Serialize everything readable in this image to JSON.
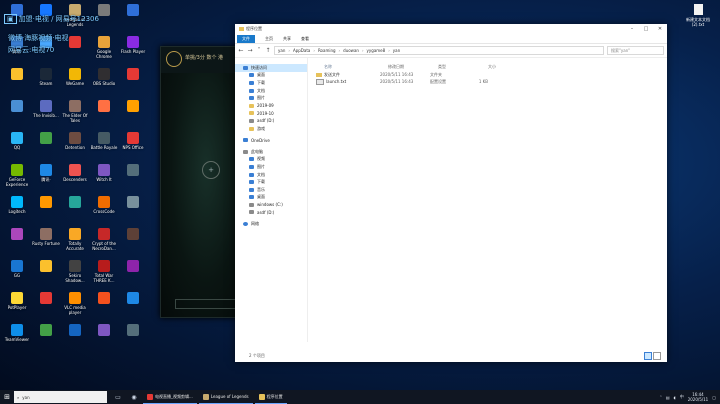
{
  "overlay": {
    "line1": "加盟·电视 / 网易号12306",
    "line2": "微博·海豚视频·电视",
    "line3": "网易云:电视70"
  },
  "desktop_icons": [
    {
      "label": "",
      "color": "#2f6fd8"
    },
    {
      "label": "",
      "color": "#1677ff"
    },
    {
      "label": "League of Legends",
      "color": "#c8aa6e"
    },
    {
      "label": "",
      "color": "#7a7a7a"
    },
    {
      "label": "",
      "color": "#2f6fd8"
    },
    {
      "label": "腾讯·",
      "color": "#3a7fd4"
    },
    {
      "label": "",
      "color": "#4aa8ff"
    },
    {
      "label": "",
      "color": "#e53935"
    },
    {
      "label": "Google Chrome",
      "color": "#e8a33a"
    },
    {
      "label": "Flash Player",
      "color": "#8a2be2"
    },
    {
      "label": "",
      "color": "#fbc02d"
    },
    {
      "label": "Steam",
      "color": "#1b2838"
    },
    {
      "label": "WeGame",
      "color": "#f2b705"
    },
    {
      "label": "OBS Studio",
      "color": "#302e31"
    },
    {
      "label": "",
      "color": "#e53935"
    },
    {
      "label": "",
      "color": "#4a8fd4"
    },
    {
      "label": "The Invisib...",
      "color": "#5c6bc0"
    },
    {
      "label": "The Elder Of Tales",
      "color": "#8d6e63"
    },
    {
      "label": "",
      "color": "#ff7043"
    },
    {
      "label": "",
      "color": "#ffa000"
    },
    {
      "label": "QQ",
      "color": "#29b6f6"
    },
    {
      "label": "",
      "color": "#43a047"
    },
    {
      "label": "Detention",
      "color": "#6d4c41"
    },
    {
      "label": "Battle Royale",
      "color": "#455a64"
    },
    {
      "label": "NPS Office",
      "color": "#e53935"
    },
    {
      "label": "GeForce Experience",
      "color": "#76b900"
    },
    {
      "label": "腾讯·",
      "color": "#1e88e5"
    },
    {
      "label": "Descenders",
      "color": "#ef5350"
    },
    {
      "label": "Witch It",
      "color": "#7e57c2"
    },
    {
      "label": "",
      "color": "#546e7a"
    },
    {
      "label": "Logitech",
      "color": "#00b8fc"
    },
    {
      "label": "",
      "color": "#ff9800"
    },
    {
      "label": "",
      "color": "#26a69a"
    },
    {
      "label": "CrossCode",
      "color": "#ef6c00"
    },
    {
      "label": "",
      "color": "#78909c"
    },
    {
      "label": "",
      "color": "#ab47bc"
    },
    {
      "label": "Rusty Fortune",
      "color": "#8d6e63"
    },
    {
      "label": "Totally Accurate",
      "color": "#f9a825"
    },
    {
      "label": "Crypt of the NecroDan...",
      "color": "#c62828"
    },
    {
      "label": "",
      "color": "#5d4037"
    },
    {
      "label": "GG",
      "color": "#1976d2"
    },
    {
      "label": "",
      "color": "#fbc02d"
    },
    {
      "label": "Sekiro Shadow...",
      "color": "#424242"
    },
    {
      "label": "Total War THREE K...",
      "color": "#b71c1c"
    },
    {
      "label": "",
      "color": "#8e24aa"
    },
    {
      "label": "PotPlayer",
      "color": "#fdd835"
    },
    {
      "label": "",
      "color": "#e53935"
    },
    {
      "label": "VLC media player",
      "color": "#ff8f00"
    },
    {
      "label": "",
      "color": "#f4511e"
    },
    {
      "label": "",
      "color": "#1e88e5"
    },
    {
      "label": "TeamViewer",
      "color": "#0e8ee9"
    },
    {
      "label": "",
      "color": "#43a047"
    },
    {
      "label": "",
      "color": "#1565c0"
    },
    {
      "label": "",
      "color": "#7e57c2"
    },
    {
      "label": "",
      "color": "#546e7a"
    }
  ],
  "lol_window": {
    "title": "单挑/3分 数个 港"
  },
  "right_icon": {
    "label": "新建文本文档 (2).txt"
  },
  "explorer": {
    "title": "程序位置",
    "ribbon": [
      "文件",
      "主页",
      "共享",
      "查看"
    ],
    "address": [
      "yan",
      "AppData",
      "Roaming",
      "duowan",
      "yygame8",
      "yan"
    ],
    "search_placeholder": "搜索\"yan\"",
    "nav": [
      {
        "label": "快速访问",
        "kind": "group",
        "icon": "star"
      },
      {
        "label": "桌面",
        "kind": "item",
        "icon": "blue"
      },
      {
        "label": "下载",
        "kind": "item",
        "icon": "blue"
      },
      {
        "label": "文档",
        "kind": "item",
        "icon": "blue"
      },
      {
        "label": "图片",
        "kind": "item",
        "icon": "blue"
      },
      {
        "label": "2019-09",
        "kind": "item",
        "icon": "folder"
      },
      {
        "label": "2019-10",
        "kind": "item",
        "icon": "folder"
      },
      {
        "label": "asdf (D:)",
        "kind": "item",
        "icon": "drive"
      },
      {
        "label": "游戏",
        "kind": "item",
        "icon": "folder"
      },
      {
        "label": "OneDrive",
        "kind": "group",
        "icon": "blue"
      },
      {
        "label": "此电脑",
        "kind": "group",
        "icon": "drive"
      },
      {
        "label": "视频",
        "kind": "item",
        "icon": "blue"
      },
      {
        "label": "图片",
        "kind": "item",
        "icon": "blue"
      },
      {
        "label": "文档",
        "kind": "item",
        "icon": "blue"
      },
      {
        "label": "下载",
        "kind": "item",
        "icon": "blue"
      },
      {
        "label": "音乐",
        "kind": "item",
        "icon": "blue"
      },
      {
        "label": "桌面",
        "kind": "item",
        "icon": "blue"
      },
      {
        "label": "windows (C:)",
        "kind": "item",
        "icon": "drive"
      },
      {
        "label": "asdf (D:)",
        "kind": "item",
        "icon": "drive"
      },
      {
        "label": "网络",
        "kind": "group",
        "icon": "net"
      }
    ],
    "columns": [
      "名称",
      "修改日期",
      "类型",
      "大小"
    ],
    "files": [
      {
        "name": "发送文件",
        "date": "2020/5/11 16:43",
        "type": "文件夹",
        "size": ""
      },
      {
        "name": "launch.txt",
        "date": "2020/5/11 16:43",
        "type": "配置设置",
        "size": "1 KB"
      }
    ],
    "status": "2 个项目"
  },
  "taskbar": {
    "search_text": "yan",
    "apps": [
      {
        "label": "电视直播_视频剪辑...",
        "color": "#e53935"
      },
      {
        "label": "League of Legends",
        "color": "#c8aa6e"
      },
      {
        "label": "程序位置",
        "color": "#e7c25a"
      }
    ],
    "time": "16:44",
    "date": "2020/5/11"
  }
}
